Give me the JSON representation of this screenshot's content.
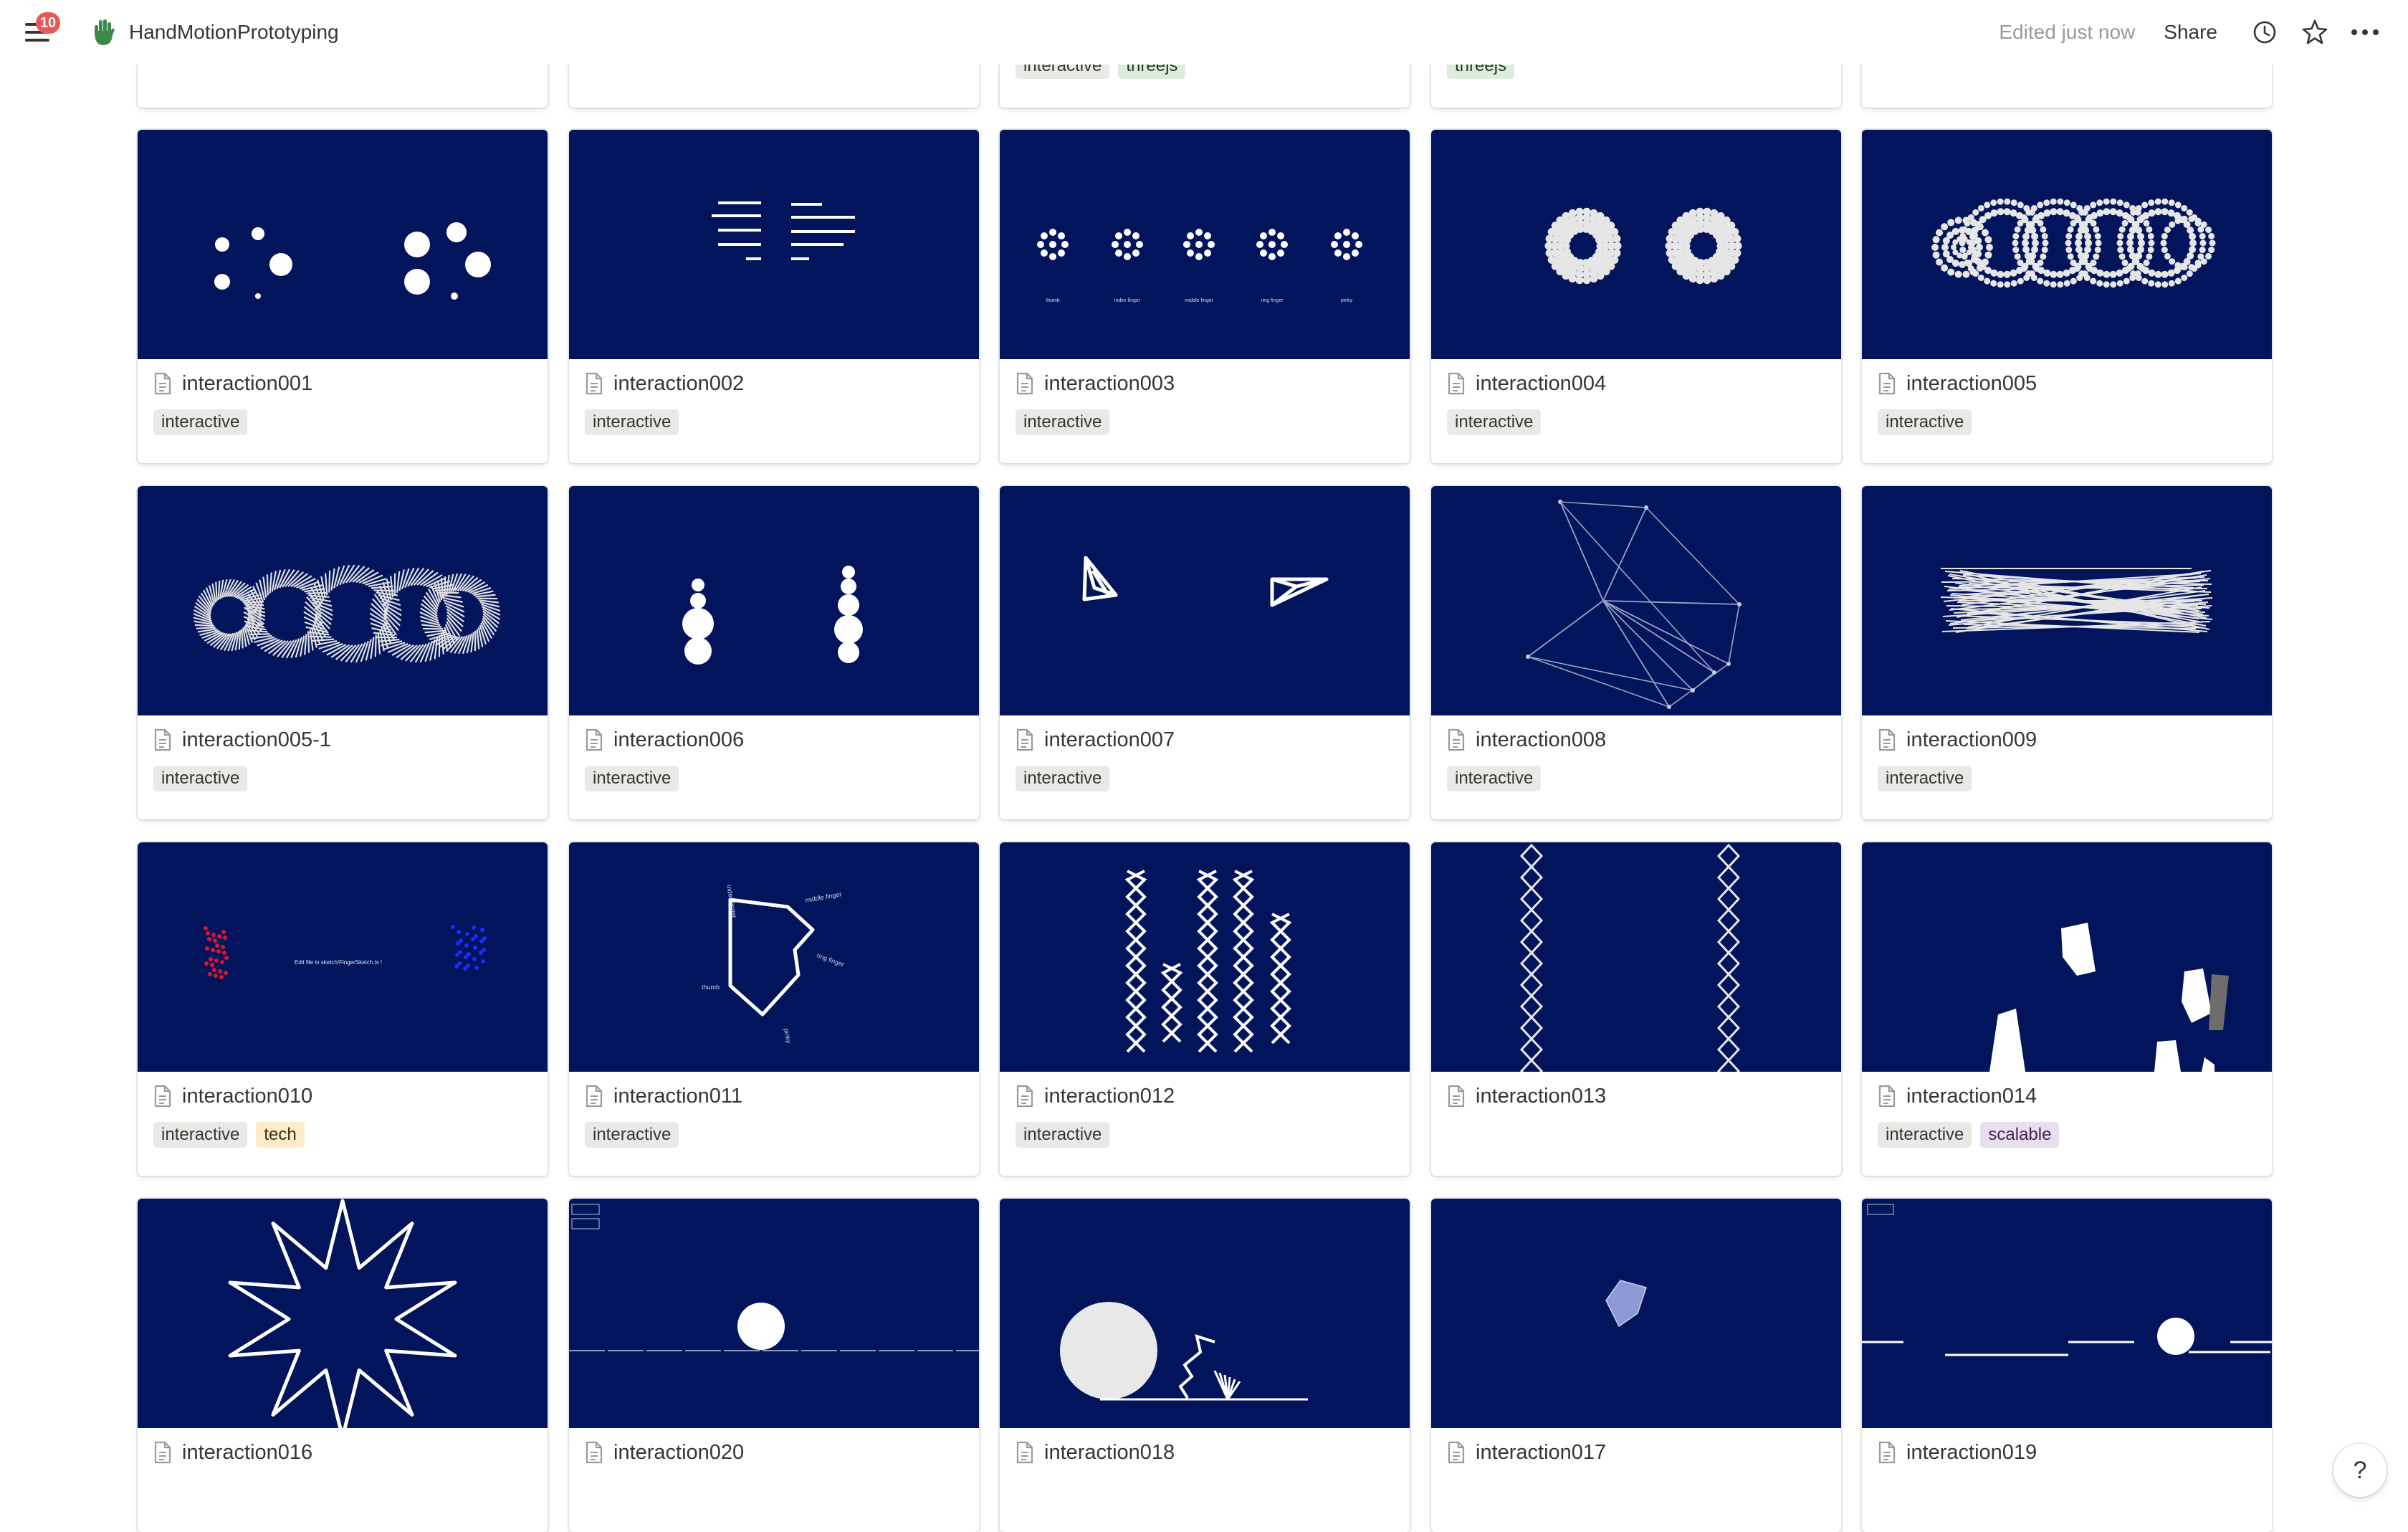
{
  "topbar": {
    "notification_count": "10",
    "page_title": "HandMotionPrototyping",
    "edited_status": "Edited just now",
    "share_label": "Share"
  },
  "partial_row_tags": [
    [],
    [],
    [
      "interactive",
      "threejs"
    ],
    [
      "threejs"
    ],
    []
  ],
  "cards": [
    {
      "title": "interaction001",
      "tags": [
        "interactive"
      ]
    },
    {
      "title": "interaction002",
      "tags": [
        "interactive"
      ]
    },
    {
      "title": "interaction003",
      "tags": [
        "interactive"
      ],
      "thumb_labels": [
        "thumb",
        "index finger",
        "middle finger",
        "ring finger",
        "pinky"
      ]
    },
    {
      "title": "interaction004",
      "tags": [
        "interactive"
      ]
    },
    {
      "title": "interaction005",
      "tags": [
        "interactive"
      ]
    },
    {
      "title": "interaction005-1",
      "tags": [
        "interactive"
      ]
    },
    {
      "title": "interaction006",
      "tags": [
        "interactive"
      ]
    },
    {
      "title": "interaction007",
      "tags": [
        "interactive"
      ]
    },
    {
      "title": "interaction008",
      "tags": [
        "interactive"
      ]
    },
    {
      "title": "interaction009",
      "tags": [
        "interactive"
      ]
    },
    {
      "title": "interaction010",
      "tags": [
        "interactive",
        "tech"
      ],
      "thumb_labels": [
        "Edit file in sketch/FingerSketch.ts !"
      ]
    },
    {
      "title": "interaction011",
      "tags": [
        "interactive"
      ],
      "thumb_labels": [
        "index finger",
        "middle finger",
        "ring finger",
        "pinky",
        "thumb"
      ]
    },
    {
      "title": "interaction012",
      "tags": [
        "interactive"
      ]
    },
    {
      "title": "interaction013",
      "tags": []
    },
    {
      "title": "interaction014",
      "tags": [
        "interactive",
        "scalable"
      ]
    },
    {
      "title": "interaction016",
      "tags": []
    },
    {
      "title": "interaction020",
      "tags": []
    },
    {
      "title": "interaction018",
      "tags": []
    },
    {
      "title": "interaction017",
      "tags": []
    },
    {
      "title": "interaction019",
      "tags": []
    }
  ],
  "help_label": "?"
}
